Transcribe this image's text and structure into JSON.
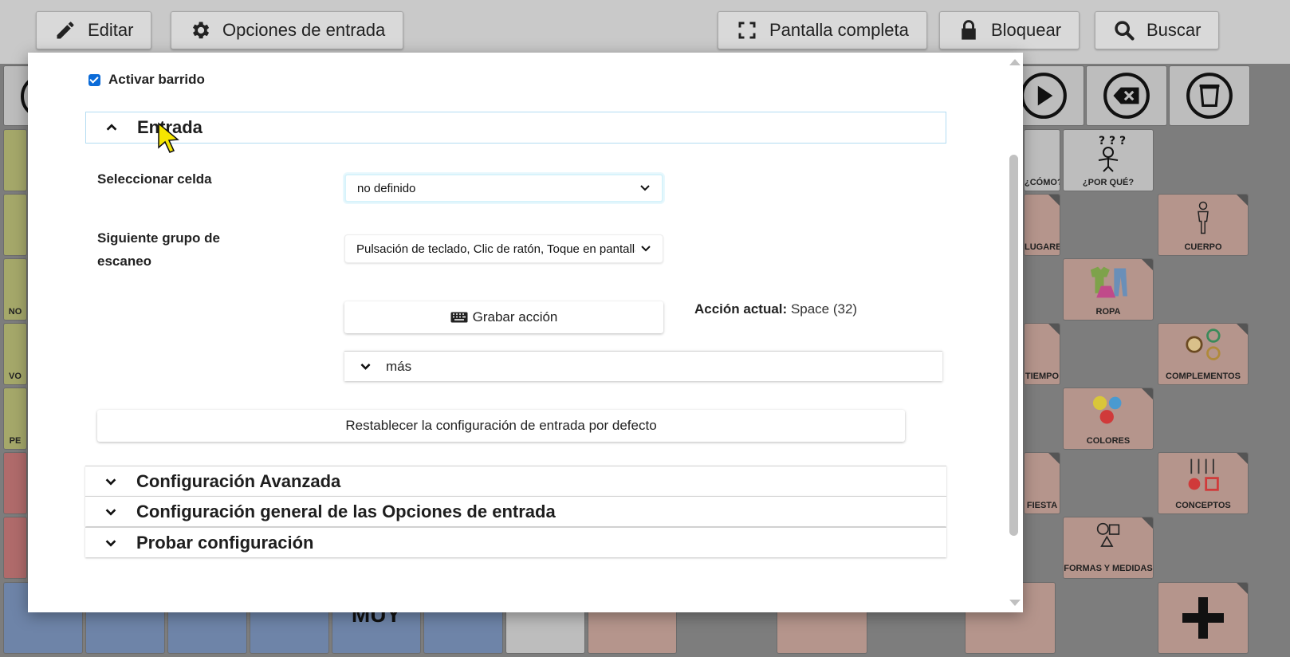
{
  "toolbar": {
    "edit_label": "Editar",
    "input_options_label": "Opciones de entrada",
    "fullscreen_label": "Pantalla completa",
    "lock_label": "Bloquear",
    "search_label": "Buscar"
  },
  "board": {
    "cells": {
      "como": "¿CÓMO?",
      "por_que": "¿POR QUÉ?",
      "lugares": "LUGARES",
      "cuerpo": "CUERPO",
      "ropa": "ROPA",
      "tiempo": "TIEMPO",
      "complementos": "COMPLEMENTOS",
      "colores": "COLORES",
      "fiesta": "FIESTA",
      "conceptos": "CONCEPTOS",
      "formas": "FORMAS Y MEDIDAS",
      "muy": "MUY",
      "left_no": "NO",
      "left_vo": "VO",
      "left_pe": "PE"
    },
    "colors": {
      "toolbar": "#c9c9c9",
      "overlay": "#7d7d7d",
      "olive": "#a5a86a",
      "red": "#b06b6b",
      "salmon": "#b5958c",
      "blue": "#6e84a8"
    }
  },
  "modal": {
    "scan_checkbox": {
      "label": "Activar barrido",
      "checked": true
    },
    "entrada": {
      "title": "Entrada",
      "select_cell_label": "Seleccionar celda",
      "select_cell_value": "no definido",
      "next_group_label": "Siguiente grupo de escaneo",
      "next_group_value": "Pulsación de teclado, Clic de ratón, Toque en pantalla",
      "record_button": "Grabar acción",
      "current_action_label": "Acción actual:",
      "current_action_value": "Space (32)",
      "more_label": "más",
      "reset_button": "Restablecer la configuración de entrada por defecto"
    },
    "advanced": "Configuración Avanzada",
    "general": "Configuración general de las Opciones de entrada",
    "test": "Probar configuración"
  }
}
